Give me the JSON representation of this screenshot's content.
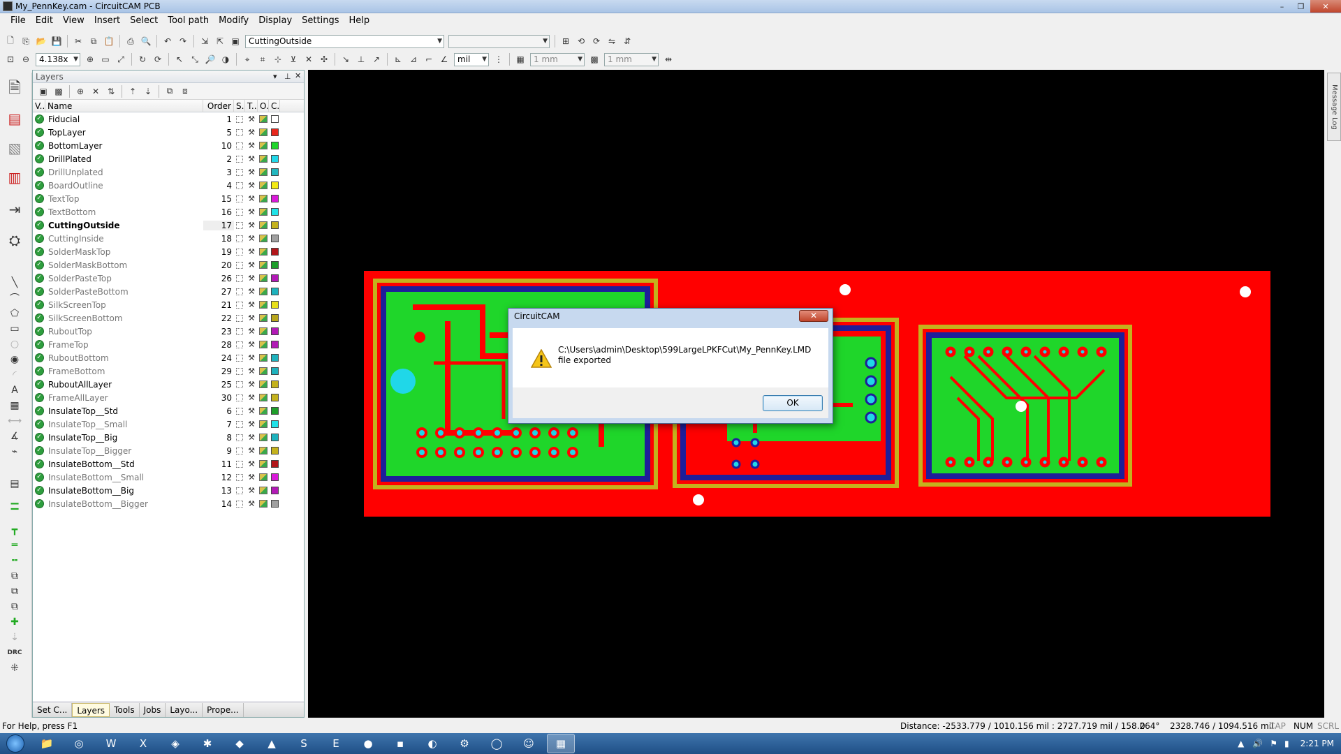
{
  "window": {
    "title": "My_PennKey.cam - CircuitCAM PCB",
    "controls": [
      "–",
      "❐",
      "✕"
    ]
  },
  "menu": [
    "File",
    "Edit",
    "View",
    "Insert",
    "Select",
    "Tool path",
    "Modify",
    "Display",
    "Settings",
    "Help"
  ],
  "toolbar": {
    "layer_combo": "CuttingOutside",
    "zoom": "4.138x",
    "unit": "mil",
    "grid1": "1 mm",
    "grid2": "1 mm"
  },
  "layers_panel": {
    "title": "Layers",
    "columns": [
      "V..",
      "Name",
      "Order",
      "S..",
      "T..",
      "O..",
      "C.."
    ],
    "rows": [
      {
        "name": "Fiducial",
        "order": "1",
        "style": "normal",
        "color": "#ffffff"
      },
      {
        "name": "TopLayer",
        "order": "5",
        "style": "normal",
        "color": "#e8261c"
      },
      {
        "name": "BottomLayer",
        "order": "10",
        "style": "normal",
        "color": "#1fd62a"
      },
      {
        "name": "DrillPlated",
        "order": "2",
        "style": "normal",
        "color": "#20d7e8"
      },
      {
        "name": "DrillUnplated",
        "order": "3",
        "style": "grey",
        "color": "#22b7bf"
      },
      {
        "name": "BoardOutline",
        "order": "4",
        "style": "grey",
        "color": "#f2ea14"
      },
      {
        "name": "TextTop",
        "order": "15",
        "style": "grey",
        "color": "#d91ad9"
      },
      {
        "name": "TextBottom",
        "order": "16",
        "style": "grey",
        "color": "#20e3e8"
      },
      {
        "name": "CuttingOutside",
        "order": "17",
        "style": "bold",
        "color": "#c4b21d"
      },
      {
        "name": "CuttingInside",
        "order": "18",
        "style": "grey",
        "color": "#a0a0a0"
      },
      {
        "name": "SolderMaskTop",
        "order": "19",
        "style": "grey",
        "color": "#b2161a"
      },
      {
        "name": "SolderMaskBottom",
        "order": "20",
        "style": "grey",
        "color": "#1e9e2a"
      },
      {
        "name": "SolderPasteTop",
        "order": "26",
        "style": "grey",
        "color": "#b21ab6"
      },
      {
        "name": "SolderPasteBottom",
        "order": "27",
        "style": "grey",
        "color": "#1eb2bd"
      },
      {
        "name": "SilkScreenTop",
        "order": "21",
        "style": "grey",
        "color": "#e8e01a"
      },
      {
        "name": "SilkScreenBottom",
        "order": "22",
        "style": "grey",
        "color": "#b8a61c"
      },
      {
        "name": "RuboutTop",
        "order": "23",
        "style": "grey",
        "color": "#b21ab6"
      },
      {
        "name": "FrameTop",
        "order": "28",
        "style": "grey",
        "color": "#b21ab6"
      },
      {
        "name": "RuboutBottom",
        "order": "24",
        "style": "grey",
        "color": "#1eb2bd"
      },
      {
        "name": "FrameBottom",
        "order": "29",
        "style": "grey",
        "color": "#1eb2bd"
      },
      {
        "name": "RuboutAllLayer",
        "order": "25",
        "style": "normal",
        "color": "#c4b21d"
      },
      {
        "name": "FrameAllLayer",
        "order": "30",
        "style": "grey",
        "color": "#c4b21d"
      },
      {
        "name": "InsulateTop__Std",
        "order": "6",
        "style": "normal",
        "color": "#1e9e2a"
      },
      {
        "name": "InsulateTop__Small",
        "order": "7",
        "style": "grey",
        "color": "#20e3e8"
      },
      {
        "name": "InsulateTop__Big",
        "order": "8",
        "style": "normal",
        "color": "#1eb2bd"
      },
      {
        "name": "InsulateTop__Bigger",
        "order": "9",
        "style": "grey",
        "color": "#c4b21d"
      },
      {
        "name": "InsulateBottom__Std",
        "order": "11",
        "style": "normal",
        "color": "#b2161a"
      },
      {
        "name": "InsulateBottom__Small",
        "order": "12",
        "style": "grey",
        "color": "#d91ad9"
      },
      {
        "name": "InsulateBottom__Big",
        "order": "13",
        "style": "normal",
        "color": "#b21ab6"
      },
      {
        "name": "InsulateBottom__Bigger",
        "order": "14",
        "style": "grey",
        "color": "#a0a0a0"
      }
    ],
    "tabs": [
      "Set C...",
      "Layers",
      "Tools",
      "Jobs",
      "Layo...",
      "Prope..."
    ]
  },
  "message_log": "Message Log",
  "dialog": {
    "title": "CircuitCAM",
    "close": "✕",
    "message": "C:\\Users\\admin\\Desktop\\599LargeLPKFCut\\My_PennKey.LMD file exported",
    "ok": "OK"
  },
  "status": {
    "help": "For Help, press F1",
    "distance": "Distance: -2533.779 / 1010.156 mil : 2727.719 mil / 158.264°",
    "zero": "0",
    "coords": "2328.746 / 1094.516 mil",
    "cap": "CAP",
    "num": "NUM",
    "scrl": "SCRL"
  },
  "taskbar": {
    "time": "2:21 PM"
  },
  "colors": {
    "board_red": "#ff0000",
    "copper_green": "#1fd62a",
    "pad_cyan": "#20d7e8",
    "outline_yellow": "#c4b21d"
  }
}
